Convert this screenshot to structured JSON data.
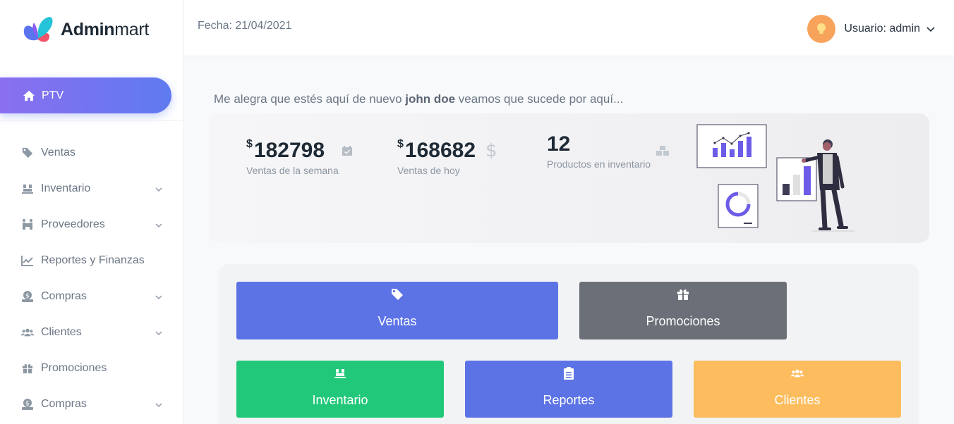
{
  "brand": {
    "name_bold": "Admin",
    "name_light": "mart"
  },
  "sidebar": {
    "active": {
      "label": "PTV",
      "icon": "home-icon"
    },
    "items": [
      {
        "label": "Ventas",
        "icon": "tag-icon",
        "expandable": false
      },
      {
        "label": "Inventario",
        "icon": "pallet-icon",
        "expandable": true
      },
      {
        "label": "Proveedores",
        "icon": "people-carry-icon",
        "expandable": true
      },
      {
        "label": "Reportes y Finanzas",
        "icon": "line-chart-icon",
        "expandable": false
      },
      {
        "label": "Compras",
        "icon": "money-bag-icon",
        "expandable": true
      },
      {
        "label": "Clientes",
        "icon": "users-icon",
        "expandable": true
      },
      {
        "label": "Promociones",
        "icon": "gift-icon",
        "expandable": false
      },
      {
        "label": "Compras",
        "icon": "money-bag-icon",
        "expandable": true
      }
    ]
  },
  "header": {
    "date_text": "Fecha: 21/04/2021",
    "user_label": "Usuario: admin"
  },
  "welcome": {
    "before": "Me alegra que estés aquí de nuevo ",
    "name": "john doe",
    "after": " veamos que sucede por aquí..."
  },
  "stats": [
    {
      "currency": "$",
      "value": "182798",
      "label": "Ventas de la semana",
      "icon": "calendar-check-icon"
    },
    {
      "currency": "$",
      "value": "168682",
      "label": "Ventas de hoy",
      "icon": "dollar-icon"
    },
    {
      "currency": "",
      "value": "12",
      "label": "Productos en inventario",
      "icon": "boxes-icon"
    }
  ],
  "tiles": [
    {
      "label": "Ventas",
      "icon": "tag-icon",
      "color": "#5c73e6"
    },
    {
      "label": "Promociones",
      "icon": "gift-icon",
      "color": "#6b6f78"
    },
    {
      "label": "Inventario",
      "icon": "pallet-icon",
      "color": "#22c87a"
    },
    {
      "label": "Reportes",
      "icon": "clipboard-list-icon",
      "color": "#5c73e6"
    },
    {
      "label": "Clientes",
      "icon": "users-icon",
      "color": "#fdbd5f"
    }
  ],
  "colors": {
    "accent_start": "#8a6ff0",
    "accent_end": "#5f7af0",
    "chart_purple": "#6c5ce7"
  }
}
